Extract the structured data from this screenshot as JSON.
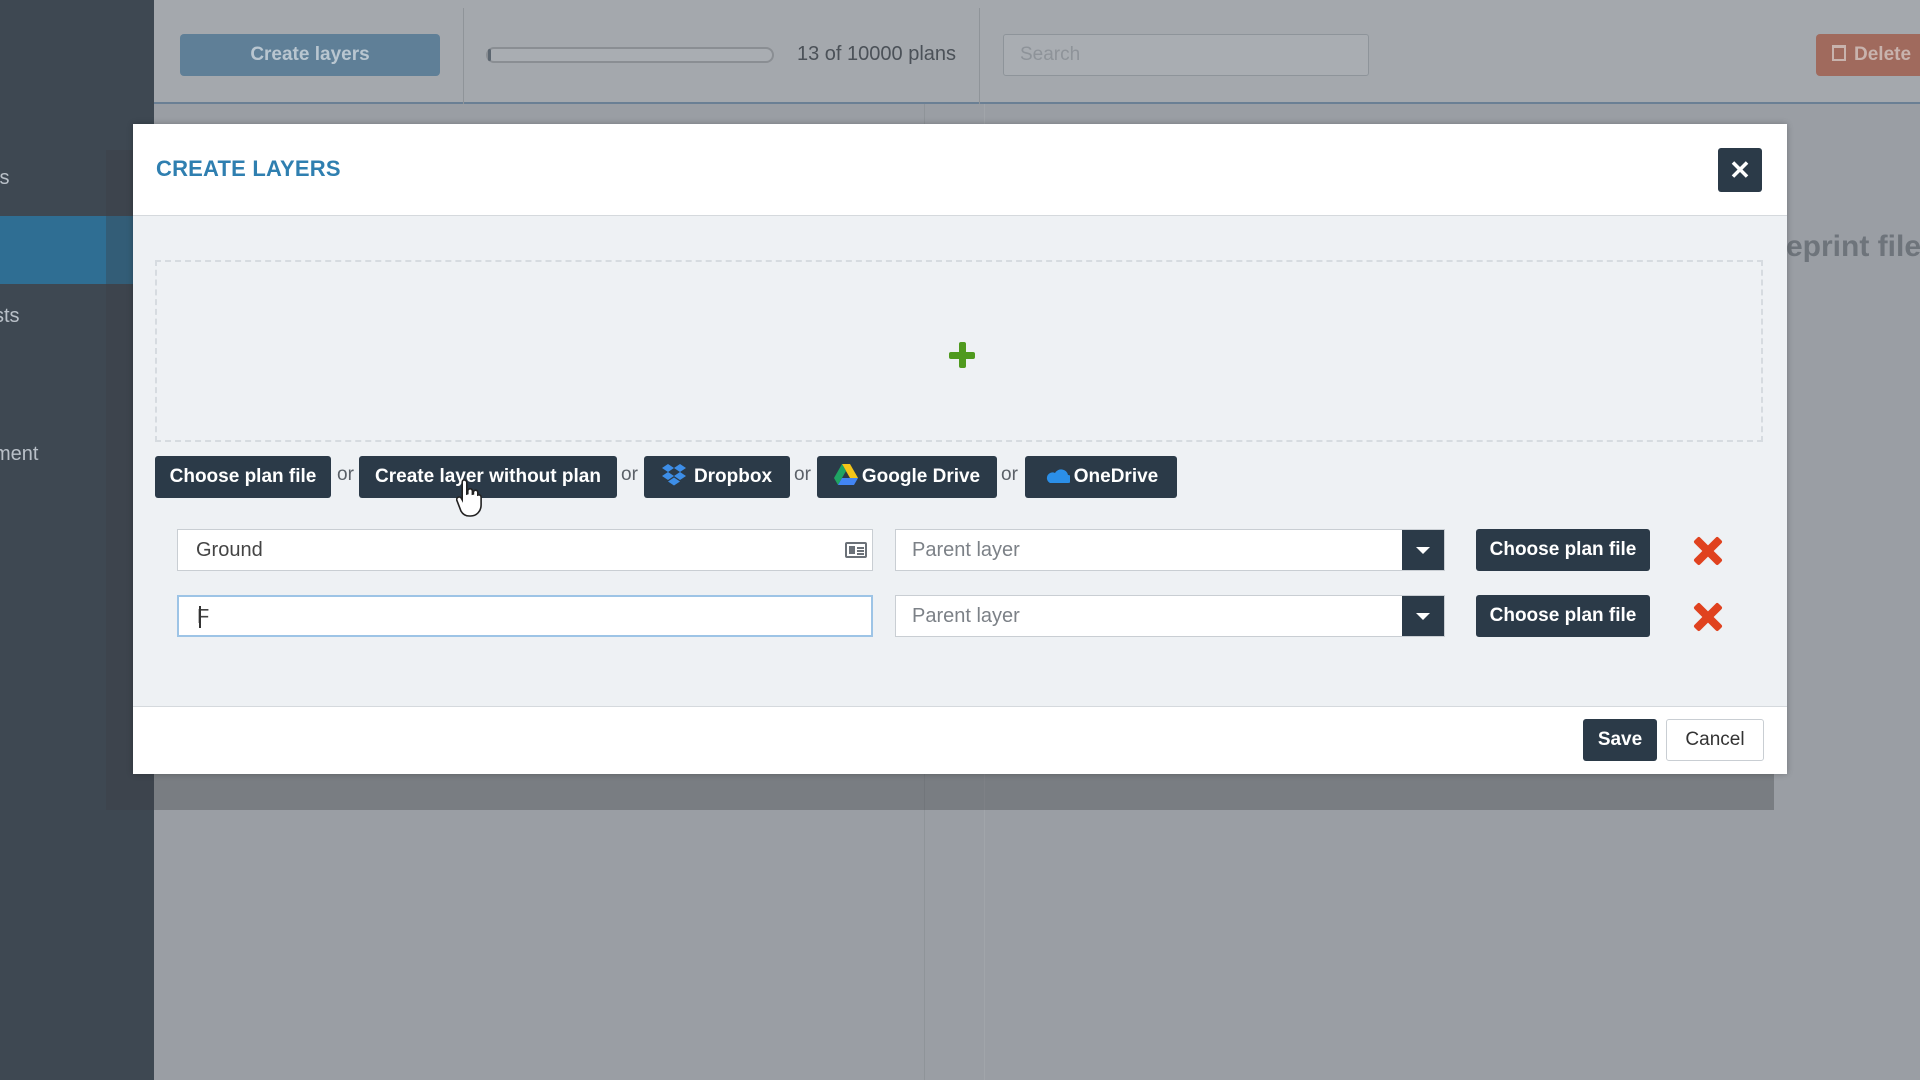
{
  "background": {
    "sidebar": {
      "items": [
        {
          "label": "ts"
        },
        {
          "label": ""
        },
        {
          "label": "sts"
        },
        {
          "label": "ment"
        }
      ]
    },
    "toolbar": {
      "create_layers_label": "Create layers",
      "plans_progress": 0.0013,
      "plans_count": "13 of 10000 plans",
      "search_placeholder": "Search",
      "delete_label": "Delete"
    },
    "main_hint": "eprint file"
  },
  "modal": {
    "title": "CREATE LAYERS",
    "close_icon": "close-icon",
    "dropzone_icon": "plus-icon",
    "sources": {
      "choose_plan_file": "Choose plan file",
      "or": "or",
      "create_without_plan": "Create layer without plan",
      "dropbox": "Dropbox",
      "google_drive": "Google Drive",
      "onedrive": "OneDrive"
    },
    "layers": [
      {
        "name": "Ground",
        "parent_placeholder": "Parent layer",
        "choose_label": "Choose plan file"
      },
      {
        "name": "F",
        "parent_placeholder": "Parent layer",
        "choose_label": "Choose plan file"
      }
    ],
    "footer": {
      "save_label": "Save",
      "cancel_label": "Cancel"
    }
  },
  "colors": {
    "primary_dark": "#2b3a48",
    "title_blue": "#2f7fb0",
    "add_green": "#4f9a1e",
    "remove_red": "#e0421f"
  }
}
